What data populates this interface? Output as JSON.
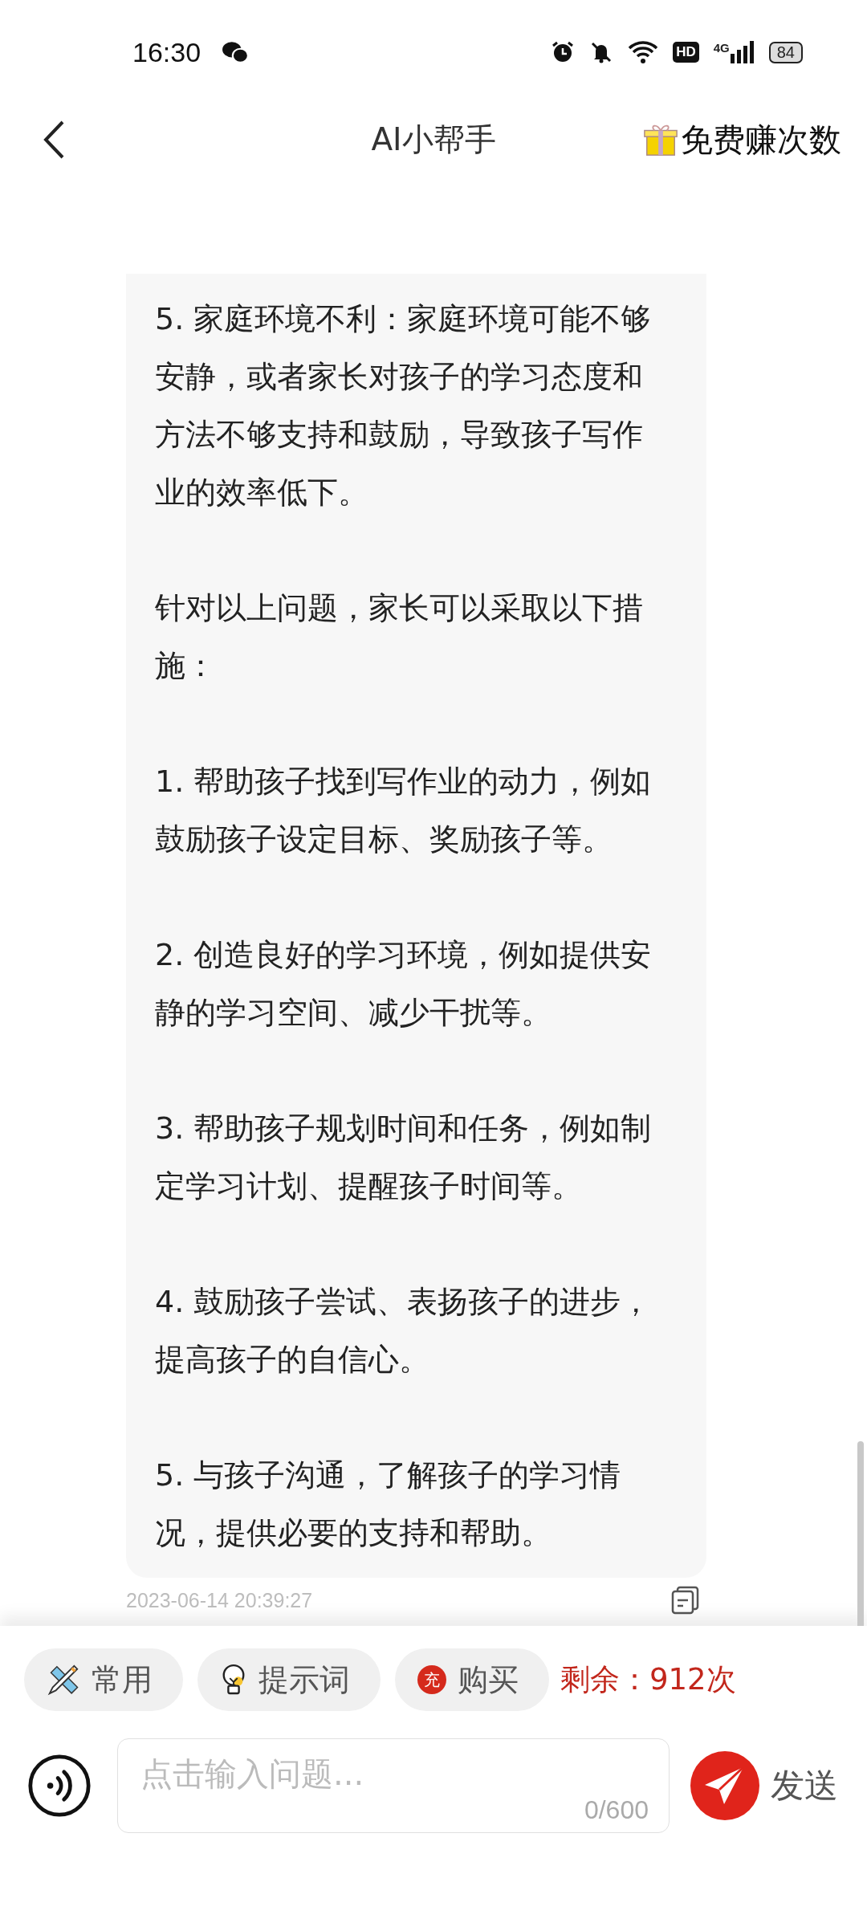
{
  "status_bar": {
    "time": "16:30",
    "hd": "HD",
    "network": "4G",
    "battery": "84"
  },
  "header": {
    "title": "AI小帮手",
    "action": "免费赚次数"
  },
  "message": {
    "paragraphs": [
      "5. 家庭环境不利：家庭环境可能不够安静，或者家长对孩子的学习态度和方法不够支持和鼓励，导致孩子写作业的效率低下。",
      "针对以上问题，家长可以采取以下措施：",
      "1. 帮助孩子找到写作业的动力，例如鼓励孩子设定目标、奖励孩子等。",
      "2. 创造良好的学习环境，例如提供安静的学习空间、减少干扰等。",
      "3. 帮助孩子规划时间和任务，例如制定学习计划、提醒孩子时间等。",
      "4. 鼓励孩子尝试、表扬孩子的进步，提高孩子的自信心。",
      "5. 与孩子沟通，了解孩子的学习情况，提供必要的支持和帮助。"
    ],
    "timestamp": "2023-06-14 20:39:27"
  },
  "chips": [
    {
      "kind": "ruler",
      "label": "常用"
    },
    {
      "kind": "bulb",
      "label": "提示词"
    },
    {
      "kind": "badge",
      "badge": "充",
      "label": "购买"
    }
  ],
  "remaining": "剩余：912次",
  "input": {
    "placeholder": "点击输入问题...",
    "counter": "0/600"
  },
  "send": "发送"
}
